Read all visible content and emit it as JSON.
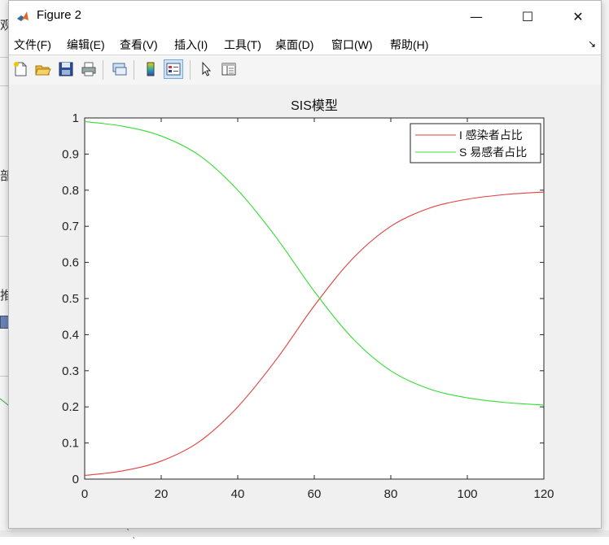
{
  "background": {
    "left_texts": [
      "观",
      "部",
      "推"
    ]
  },
  "window": {
    "title": "Figure 2",
    "minimize_glyph": "—",
    "maximize_glyph": "☐",
    "close_glyph": "✕"
  },
  "menubar": {
    "items": [
      "文件(F)",
      "编辑(E)",
      "查看(V)",
      "插入(I)",
      "工具(T)",
      "桌面(D)",
      "窗口(W)",
      "帮助(H)"
    ],
    "overflow_glyph": "↘"
  },
  "toolbar": {
    "icons": [
      "new-figure-icon",
      "open-file-icon",
      "save-icon",
      "print-icon",
      "link-plot-icon",
      "insert-colorbar-icon",
      "insert-legend-icon",
      "edit-plot-arrow-icon",
      "property-inspector-icon"
    ]
  },
  "chart_data": {
    "type": "line",
    "title": "SIS模型",
    "xlabel": "",
    "ylabel": "",
    "xlim": [
      0,
      120
    ],
    "ylim": [
      0,
      1
    ],
    "xticks": [
      "0",
      "20",
      "40",
      "60",
      "80",
      "100",
      "120"
    ],
    "yticks": [
      "0",
      "0.1",
      "0.2",
      "0.3",
      "0.4",
      "0.5",
      "0.6",
      "0.7",
      "0.8",
      "0.9",
      "1"
    ],
    "grid": false,
    "legend_position": "top-right",
    "x": [
      0,
      10,
      20,
      30,
      40,
      50,
      60,
      70,
      80,
      90,
      100,
      110,
      120
    ],
    "series": [
      {
        "name": "I 感染者占比",
        "color": "#e04040",
        "values": [
          0.01,
          0.023,
          0.05,
          0.104,
          0.2,
          0.33,
          0.48,
          0.61,
          0.7,
          0.75,
          0.775,
          0.788,
          0.795
        ]
      },
      {
        "name": "S 易感者占比",
        "color": "#33dd33",
        "values": [
          0.99,
          0.977,
          0.95,
          0.896,
          0.8,
          0.67,
          0.52,
          0.39,
          0.3,
          0.25,
          0.225,
          0.212,
          0.205
        ]
      }
    ]
  }
}
